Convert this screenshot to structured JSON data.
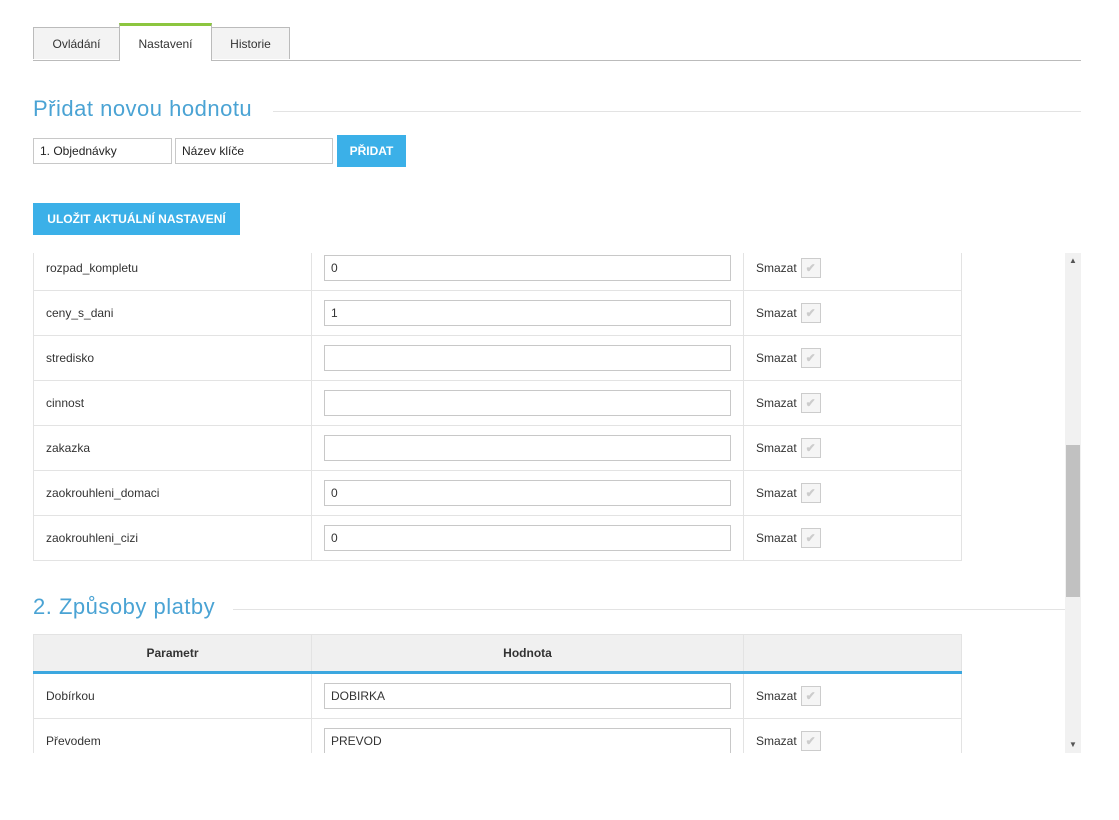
{
  "tabs": [
    {
      "label": "Ovládání",
      "active": false
    },
    {
      "label": "Nastavení",
      "active": true
    },
    {
      "label": "Historie",
      "active": false
    }
  ],
  "add_section": {
    "title": "Přidat novou hodnotu",
    "select_value": "1. Objednávky",
    "key_placeholder": "Název klíče",
    "add_button": "PŘIDAT"
  },
  "save_button": "ULOŽIT AKTUÁLNÍ NASTAVENÍ",
  "section1": {
    "rows": [
      {
        "key": "rozpad_kompletu",
        "value": "0",
        "delete": "Smazat"
      },
      {
        "key": "ceny_s_dani",
        "value": "1",
        "delete": "Smazat"
      },
      {
        "key": "stredisko",
        "value": "",
        "delete": "Smazat"
      },
      {
        "key": "cinnost",
        "value": "",
        "delete": "Smazat"
      },
      {
        "key": "zakazka",
        "value": "",
        "delete": "Smazat"
      },
      {
        "key": "zaokrouhleni_domaci",
        "value": "0",
        "delete": "Smazat"
      },
      {
        "key": "zaokrouhleni_cizi",
        "value": "0",
        "delete": "Smazat"
      }
    ]
  },
  "section2": {
    "title": "2. Způsoby platby",
    "headers": [
      "Parametr",
      "Hodnota",
      ""
    ],
    "rows": [
      {
        "key": "Dobírkou",
        "value": "DOBIRKA",
        "delete": "Smazat"
      },
      {
        "key": "Převodem",
        "value": "PREVOD",
        "delete": "Smazat"
      }
    ]
  },
  "icons": {
    "checkbox": "check-icon",
    "scroll_up": "triangle-up-icon",
    "scroll_down": "triangle-down-icon"
  },
  "colors": {
    "accent": "#3bb0e8",
    "title": "#4aa3d4",
    "tab_active": "#8cc63f"
  }
}
